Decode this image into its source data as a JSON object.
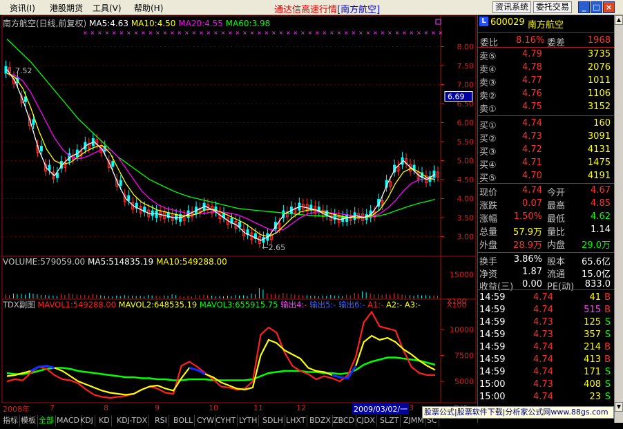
{
  "menu": [
    {
      "label": "资讯(I)"
    },
    {
      "label": "港股期货"
    },
    {
      "label": "工具(V)"
    },
    {
      "label": "帮助(H)"
    }
  ],
  "app_title": "通达信高速行情",
  "stock_title_bracket": "[南方航空]",
  "toolbar_buttons": {
    "news_system": "资讯系统",
    "trade": "委托交易"
  },
  "window_buttons": {
    "minimize": "_",
    "maximize": "□",
    "close": "×"
  },
  "main_legend": {
    "name": "南方航空(日线,前复权)",
    "ma5": "MA5:4.63",
    "ma10": "MA10:4.50",
    "ma20": "MA20:4.55",
    "ma60": "MA60:3.98"
  },
  "main_axis": {
    "ticks": [
      "8.00",
      "7.50",
      "7.00",
      "6.50",
      "6.00",
      "5.50",
      "5.00",
      "4.50",
      "4.00",
      "3.50",
      "3.00"
    ],
    "price_tag": "6.69",
    "high_note": "7.52",
    "low_note": "2.65"
  },
  "volume_legend": {
    "vol": "VOLUME:579059.00",
    "ma5": "MA5:514835.19",
    "ma10": "MA10:549288.00"
  },
  "volume_axis": {
    "tick": "15000",
    "unit": "X100"
  },
  "sub_legend": {
    "name": "TDX副图",
    "mavol1": "MAVOL1:549288.00",
    "mavol2": "MAVOL2:648535.19",
    "mavol3": "MAVOL3:655915.75",
    "out4": "输出4:-",
    "out5": "输出5:-",
    "out6": "输出6:-",
    "a1": "A1:-",
    "a2": "A2:-",
    "a3": "A3:-"
  },
  "sub_axis": {
    "ticks": [
      "10000",
      "7500",
      "5000"
    ],
    "unit": "X100"
  },
  "x_axis": {
    "labels": [
      "2008年",
      "7",
      "8",
      "9",
      "10",
      "11",
      "12",
      "2009/03/02/一",
      "3"
    ],
    "right_label": "日线"
  },
  "quote": {
    "code": "600029",
    "name": "南方航空",
    "weibi_label": "委比",
    "weibi": "8.16%",
    "weicha_label": "委差",
    "weicha": "1968",
    "sell": [
      {
        "label": "卖⑤",
        "price": "4.79",
        "vol": "3735"
      },
      {
        "label": "卖④",
        "price": "4.78",
        "vol": "2076"
      },
      {
        "label": "卖③",
        "price": "4.77",
        "vol": "1011"
      },
      {
        "label": "卖②",
        "price": "4.76",
        "vol": "1106"
      },
      {
        "label": "卖①",
        "price": "4.75",
        "vol": "3152"
      }
    ],
    "buy": [
      {
        "label": "买①",
        "price": "4.74",
        "vol": "160"
      },
      {
        "label": "买②",
        "price": "4.73",
        "vol": "3091"
      },
      {
        "label": "买③",
        "price": "4.72",
        "vol": "4131"
      },
      {
        "label": "买④",
        "price": "4.71",
        "vol": "1475"
      },
      {
        "label": "买⑤",
        "price": "4.70",
        "vol": "4191"
      }
    ],
    "stats": [
      {
        "l1": "现价",
        "v1": "4.74",
        "l2": "今开",
        "v2": "4.67"
      },
      {
        "l1": "涨跌",
        "v1": "0.07",
        "l2": "最高",
        "v2": "4.85"
      },
      {
        "l1": "涨幅",
        "v1": "1.50%",
        "l2": "最低",
        "v2": "4.62"
      },
      {
        "l1": "总量",
        "v1": "57.9万",
        "l2": "量比",
        "v2": "1.14"
      },
      {
        "l1": "外盘",
        "v1": "28.9万",
        "l2": "内盘",
        "v2": "29.0万"
      }
    ],
    "stats2": [
      {
        "l1": "换手",
        "v1": "3.86%",
        "l2": "股本",
        "v2": "65.6亿"
      },
      {
        "l1": "净资",
        "v1": "1.87",
        "l2": "流通",
        "v2": "15.0亿"
      },
      {
        "l1": "收益(三)",
        "v1": "0.00",
        "l2": "PE(动)",
        "v2": "833.0"
      }
    ],
    "ticks": [
      {
        "time": "14:59",
        "price": "4.74",
        "vol": "41",
        "bs": "B"
      },
      {
        "time": "14:59",
        "price": "4.74",
        "vol": "515",
        "bs": "B"
      },
      {
        "time": "14:59",
        "price": "4.73",
        "vol": "125",
        "bs": "S"
      },
      {
        "time": "14:59",
        "price": "4.73",
        "vol": "357",
        "bs": "S"
      },
      {
        "time": "14:59",
        "price": "4.74",
        "vol": "214",
        "bs": "B"
      },
      {
        "time": "14:59",
        "price": "4.74",
        "vol": "413",
        "bs": "B"
      },
      {
        "time": "14:59",
        "price": "4.74",
        "vol": "171",
        "bs": "S"
      },
      {
        "time": "15:00",
        "price": "4.73",
        "vol": "408",
        "bs": "S"
      },
      {
        "time": "15:00",
        "price": "4.74",
        "vol": "23",
        "bs": "S"
      }
    ]
  },
  "tabs": [
    "指标",
    "模板",
    "全部",
    "MACD",
    "KDJ",
    "KD",
    "KDJ-TDX",
    "RSI",
    "BOLL",
    "CYW",
    "CYHT",
    "LYTH",
    "SDLH",
    "LHXT",
    "BDZX",
    "ZBCD",
    "CJDX",
    "SLZT",
    "ZJMM",
    "SC"
  ],
  "promo": "股票公式|股票软件下载|分析家公式网www.88gs.com",
  "colors": {
    "ma5": "#ffffff",
    "ma10": "#ffff00",
    "ma20": "#ff00ff",
    "ma60": "#00ff00",
    "up": "#ff3030",
    "down": "#00ffff",
    "mavol1": "#ff2020",
    "mavol2": "#ffff00",
    "mavol3": "#00ff00"
  },
  "chart_data": {
    "type": "line",
    "price_ylim": [
      2.5,
      8.5
    ],
    "ma5": [
      7.4,
      7.1,
      6.6,
      6.0,
      5.3,
      4.8,
      4.6,
      4.9,
      5.1,
      5.2,
      5.4,
      5.5,
      5.3,
      4.9,
      4.4,
      4.0,
      3.8,
      3.7,
      3.6,
      3.6,
      3.55,
      3.5,
      3.5,
      3.6,
      3.7,
      3.8,
      3.7,
      3.55,
      3.4,
      3.3,
      3.1,
      3.0,
      2.9,
      3.0,
      3.3,
      3.6,
      3.7,
      3.8,
      3.75,
      3.7,
      3.6,
      3.5,
      3.45,
      3.5,
      3.55,
      3.5,
      3.6,
      3.9,
      4.4,
      4.8,
      5.0,
      4.8,
      4.6,
      4.5,
      4.65
    ],
    "ma10": [
      7.3,
      7.2,
      6.9,
      6.4,
      5.8,
      5.3,
      5.0,
      4.9,
      4.95,
      5.1,
      5.25,
      5.35,
      5.4,
      5.2,
      4.8,
      4.4,
      4.1,
      3.9,
      3.8,
      3.7,
      3.65,
      3.6,
      3.55,
      3.55,
      3.6,
      3.7,
      3.72,
      3.65,
      3.55,
      3.45,
      3.35,
      3.2,
      3.05,
      3.0,
      3.1,
      3.3,
      3.5,
      3.65,
      3.7,
      3.7,
      3.65,
      3.6,
      3.55,
      3.5,
      3.5,
      3.5,
      3.55,
      3.7,
      4.0,
      4.4,
      4.7,
      4.8,
      4.7,
      4.55,
      4.5
    ],
    "ma20": [
      7.3,
      7.25,
      7.1,
      6.8,
      6.4,
      6.0,
      5.6,
      5.3,
      5.1,
      5.05,
      5.1,
      5.2,
      5.3,
      5.3,
      5.1,
      4.8,
      4.5,
      4.2,
      4.0,
      3.85,
      3.75,
      3.7,
      3.65,
      3.6,
      3.6,
      3.62,
      3.65,
      3.65,
      3.62,
      3.58,
      3.5,
      3.4,
      3.3,
      3.2,
      3.15,
      3.2,
      3.35,
      3.5,
      3.6,
      3.65,
      3.65,
      3.62,
      3.6,
      3.57,
      3.55,
      3.52,
      3.52,
      3.6,
      3.75,
      3.95,
      4.2,
      4.4,
      4.5,
      4.52,
      4.55
    ],
    "ma60": [
      8.2,
      8.0,
      7.8,
      7.6,
      7.35,
      7.1,
      6.85,
      6.6,
      6.35,
      6.1,
      5.9,
      5.7,
      5.5,
      5.3,
      5.1,
      4.95,
      4.8,
      4.65,
      4.5,
      4.4,
      4.3,
      4.2,
      4.12,
      4.05,
      4.0,
      3.95,
      3.9,
      3.85,
      3.8,
      3.75,
      3.72,
      3.7,
      3.68,
      3.66,
      3.64,
      3.62,
      3.6,
      3.58,
      3.56,
      3.55,
      3.54,
      3.53,
      3.52,
      3.5,
      3.5,
      3.5,
      3.52,
      3.55,
      3.6,
      3.68,
      3.75,
      3.82,
      3.88,
      3.93,
      3.98
    ],
    "sub_ylim": [
      3000,
      12000
    ],
    "mavol1": [
      5000,
      5200,
      5100,
      5800,
      6400,
      6200,
      5600,
      5200,
      5100,
      4800,
      4200,
      3700,
      3500,
      3400,
      3500,
      3600,
      3800,
      4200,
      4500,
      4300,
      3900,
      3800,
      6500,
      6900,
      6400,
      5800,
      5200,
      4500,
      4400,
      4200,
      4300,
      5000,
      9500,
      10200,
      9700,
      7800,
      6500,
      6000,
      5700,
      5200,
      5500,
      5300,
      5000,
      5600,
      7400,
      10700,
      11700,
      10300,
      10100,
      9900,
      8000,
      6400,
      5800,
      5600,
      5600
    ],
    "mavol2": [
      5500,
      5600,
      5800,
      6000,
      6400,
      6500,
      6300,
      6000,
      5500,
      5000,
      4700,
      4400,
      4100,
      3900,
      3800,
      3700,
      3800,
      4200,
      4500,
      4600,
      4300,
      4100,
      5300,
      6300,
      6100,
      5700,
      5400,
      4900,
      4600,
      4300,
      4200,
      4400,
      7500,
      9000,
      8700,
      8000,
      7600,
      7200,
      6300,
      6000,
      5900,
      5600,
      5400,
      5300,
      6500,
      8800,
      9400,
      9000,
      9200,
      8800,
      8100,
      7600,
      7000,
      6500,
      6100
    ],
    "mavol3": [
      5800,
      5700,
      5700,
      5800,
      6000,
      6200,
      6300,
      6300,
      6200,
      6000,
      5900,
      5800,
      5700,
      5600,
      5500,
      5400,
      5400,
      5300,
      5300,
      5200,
      5200,
      5100,
      5100,
      5200,
      5200,
      5200,
      5100,
      5100,
      5100,
      5100,
      5100,
      5200,
      5500,
      5800,
      5900,
      6000,
      6000,
      6000,
      5900,
      5900,
      5800,
      5800,
      5700,
      5800,
      6100,
      6600,
      6900,
      7100,
      7300,
      7300,
      7200,
      7100,
      7000,
      6800,
      6600
    ],
    "volume_ylim": [
      0,
      20000
    ],
    "volume": [
      2500,
      3000,
      2800,
      3500,
      2600,
      2200,
      1800,
      2600,
      3200,
      2500,
      2200,
      2800,
      2000,
      1500,
      1800,
      2100,
      1800,
      1600,
      2200,
      1700,
      1900,
      2500,
      1400,
      1600,
      2300,
      2400,
      1700,
      1600,
      1800,
      2200,
      2000,
      3000,
      6500,
      3200,
      2800,
      3500,
      2800,
      2200,
      2000,
      1800,
      1900,
      2200,
      1800,
      2300,
      3500,
      4500,
      3000,
      2600,
      2800,
      3300,
      2400,
      2000,
      2300,
      2100,
      1900
    ]
  }
}
